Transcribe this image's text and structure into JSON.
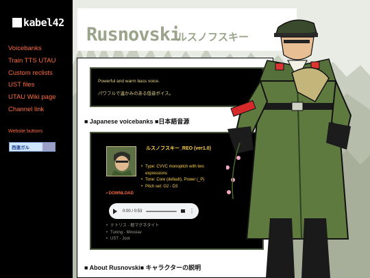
{
  "site": {
    "logo_text": "kabel42"
  },
  "sidebar": {
    "nav": [
      "Voicebanks",
      "Train TTS UTAU",
      "Custom reclists",
      "UST files",
      "UTAU Wiki page",
      "Channel link"
    ],
    "website_buttons_title": "Website buttons",
    "button_text": "西連ガル"
  },
  "header": {
    "title": "Rusnovski",
    "kana": "ルスノフスキー"
  },
  "description": {
    "en": "Powerful and warm bass voice.",
    "jp": "パワフルで温かみのある低音ボイス。"
  },
  "sections": {
    "japanese": "■ Japanese voicebanks ■日本語音源",
    "about": "■ About Rusnovski■ キャラクターの説明"
  },
  "voicebank": {
    "name": "ルスノフスキー_REO (ver1.0)",
    "info": [
      "Type: CVVC monopitch with two expressions",
      "Tone: Core (default), Power (_P)",
      "Pitch set: G2 - D3"
    ],
    "download": "DOWNLOAD",
    "audio_time": "0:00 / 0:53",
    "credits": [
      "テトリス - 軽マグネタイト",
      "Tuning - Miroslav",
      "UST - Joot"
    ]
  },
  "colors": {
    "accent": "#ff6a3d",
    "vb_text": "#ffd34a",
    "header_title": "#9aa48a"
  }
}
